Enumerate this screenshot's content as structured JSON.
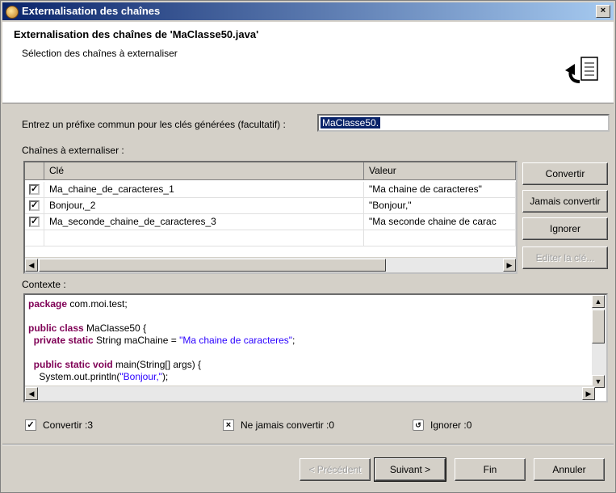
{
  "window": {
    "title": "Externalisation des chaînes",
    "close": "×"
  },
  "header": {
    "title": "Externalisation des chaînes de 'MaClasse50.java'",
    "subtitle": "Sélection des chaînes à externaliser",
    "icon": "externalize-icon"
  },
  "prefix": {
    "label": "Entrez un préfixe commun pour les clés générées (facultatif) :",
    "value": "MaClasse50."
  },
  "strings_label": "Chaînes à externaliser :",
  "table": {
    "columns": [
      "",
      "Clé",
      "Valeur"
    ],
    "rows": [
      {
        "checked": true,
        "key": "Ma_chaine_de_caracteres_1",
        "value": "\"Ma chaine de caracteres\""
      },
      {
        "checked": true,
        "key": "Bonjour,_2",
        "value": "\"Bonjour,\""
      },
      {
        "checked": true,
        "key": "Ma_seconde_chaine_de_caracteres_3",
        "value": "\"Ma seconde chaine de carac"
      }
    ]
  },
  "side_buttons": {
    "convert": "Convertir",
    "never_convert": "Jamais convertir",
    "ignore": "Ignorer",
    "edit_key": "Editer la clé..."
  },
  "context": {
    "label": "Contexte :",
    "lines": [
      [
        {
          "t": "package",
          "c": "kw"
        },
        {
          "t": " com.moi.test;",
          "c": ""
        }
      ],
      [],
      [
        {
          "t": "public class",
          "c": "kw"
        },
        {
          "t": " MaClasse50 {",
          "c": ""
        }
      ],
      [
        {
          "t": "  private static",
          "c": "kw"
        },
        {
          "t": " String maChaine = ",
          "c": ""
        },
        {
          "t": "\"Ma chaine de caracteres\"",
          "c": "str"
        },
        {
          "t": ";",
          "c": ""
        }
      ],
      [],
      [
        {
          "t": "  public static void",
          "c": "kw"
        },
        {
          "t": " main(String[] args) {",
          "c": ""
        }
      ],
      [
        {
          "t": "    System.out.println(",
          "c": ""
        },
        {
          "t": "\"Bonjour,\"",
          "c": "str"
        },
        {
          "t": ");",
          "c": ""
        }
      ]
    ]
  },
  "status": {
    "convert": "Convertir :3",
    "never_convert": "Ne jamais convertir :0",
    "ignore": "Ignorer :0"
  },
  "footer": {
    "back": "< Précédent",
    "next": "Suivant >",
    "finish": "Fin",
    "cancel": "Annuler"
  }
}
